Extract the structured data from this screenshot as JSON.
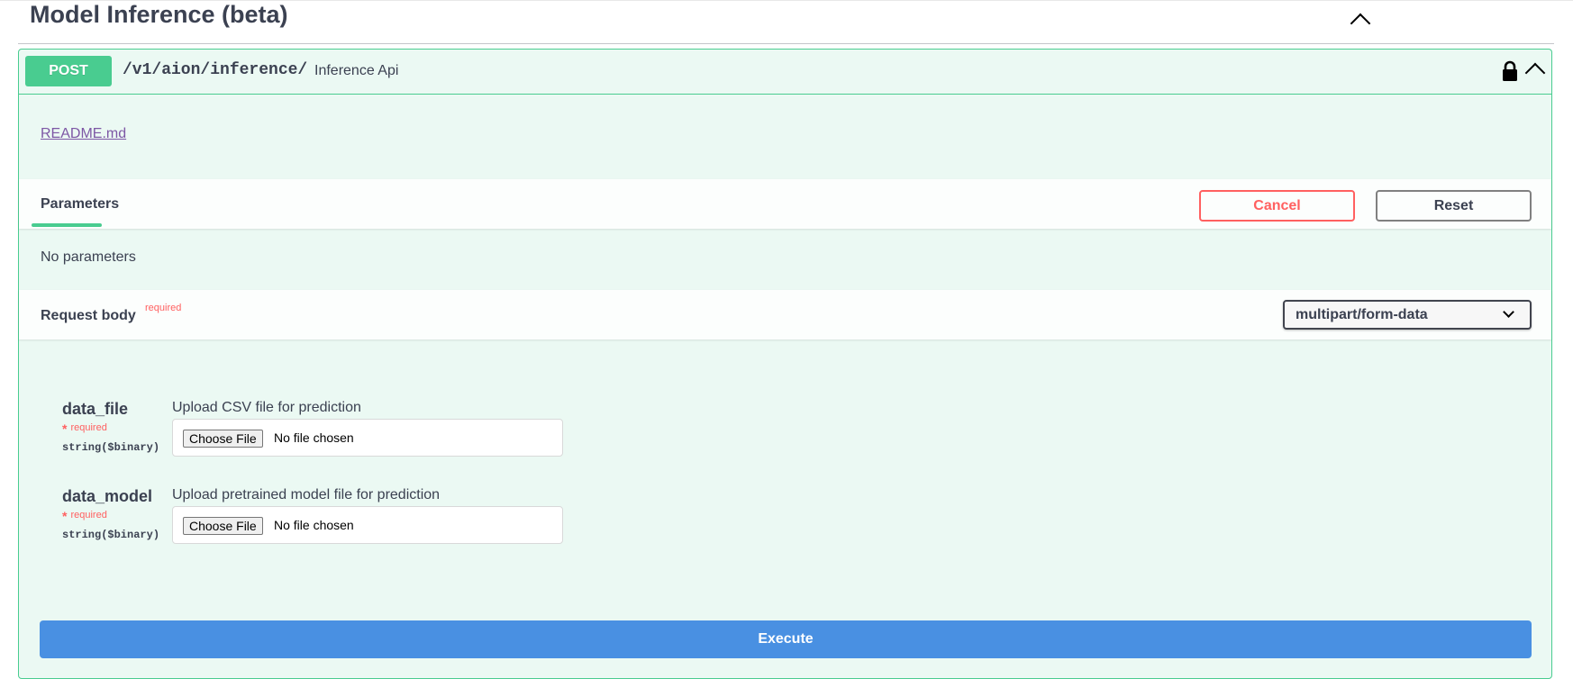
{
  "section": {
    "title": "Model Inference (beta)"
  },
  "operation": {
    "method": "POST",
    "path": "/v1/aion/inference/",
    "summary": "Inference Api",
    "readme_link": "README.md"
  },
  "parameters": {
    "tab_label": "Parameters",
    "cancel_label": "Cancel",
    "reset_label": "Reset",
    "empty_text": "No parameters"
  },
  "request_body": {
    "title": "Request body",
    "required_label": "required",
    "content_type": "multipart/form-data",
    "fields": [
      {
        "name": "data_file",
        "required_star": "*",
        "required_label": "required",
        "type": "string($binary)",
        "description": "Upload CSV file for prediction",
        "choose_label": "Choose File",
        "file_status": "No file chosen"
      },
      {
        "name": "data_model",
        "required_star": "*",
        "required_label": "required",
        "type": "string($binary)",
        "description": "Upload pretrained model file for prediction",
        "choose_label": "Choose File",
        "file_status": "No file chosen"
      }
    ]
  },
  "execute_label": "Execute",
  "colors": {
    "post_accent": "#49cc90",
    "cancel": "#ff6060",
    "execute": "#4990e2",
    "link": "#7d57a5"
  },
  "icons": {
    "section_collapse": "chevron-up-icon",
    "lock": "lock-icon",
    "operation_collapse": "chevron-up-icon",
    "select_arrow": "chevron-down-icon"
  }
}
